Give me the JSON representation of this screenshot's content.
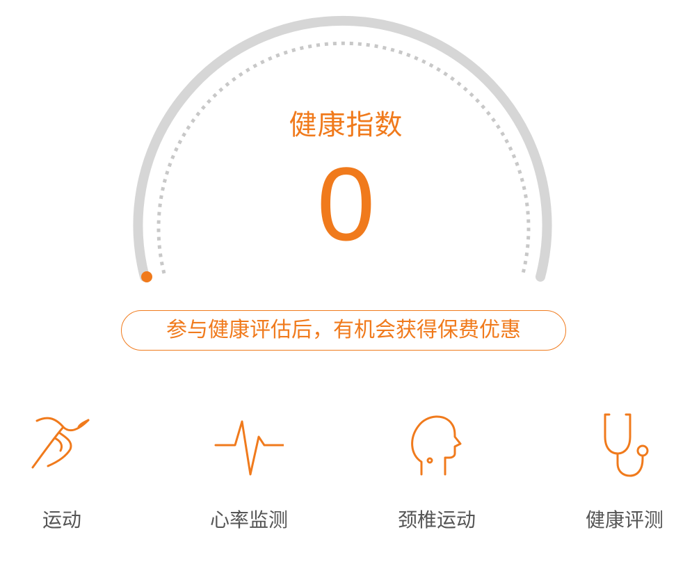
{
  "health": {
    "title": "健康指数",
    "score": "0",
    "promo": "参与健康评估后，有机会获得保费优惠"
  },
  "features": [
    {
      "label": "运动",
      "icon": "running-icon"
    },
    {
      "label": "心率监测",
      "icon": "heartbeat-icon"
    },
    {
      "label": "颈椎运动",
      "icon": "head-profile-icon"
    },
    {
      "label": "健康评测",
      "icon": "stethoscope-icon"
    }
  ],
  "colors": {
    "accent": "#f07a1c",
    "track": "#d6d6d6",
    "dots": "#c8c8c8",
    "label": "#555555"
  }
}
